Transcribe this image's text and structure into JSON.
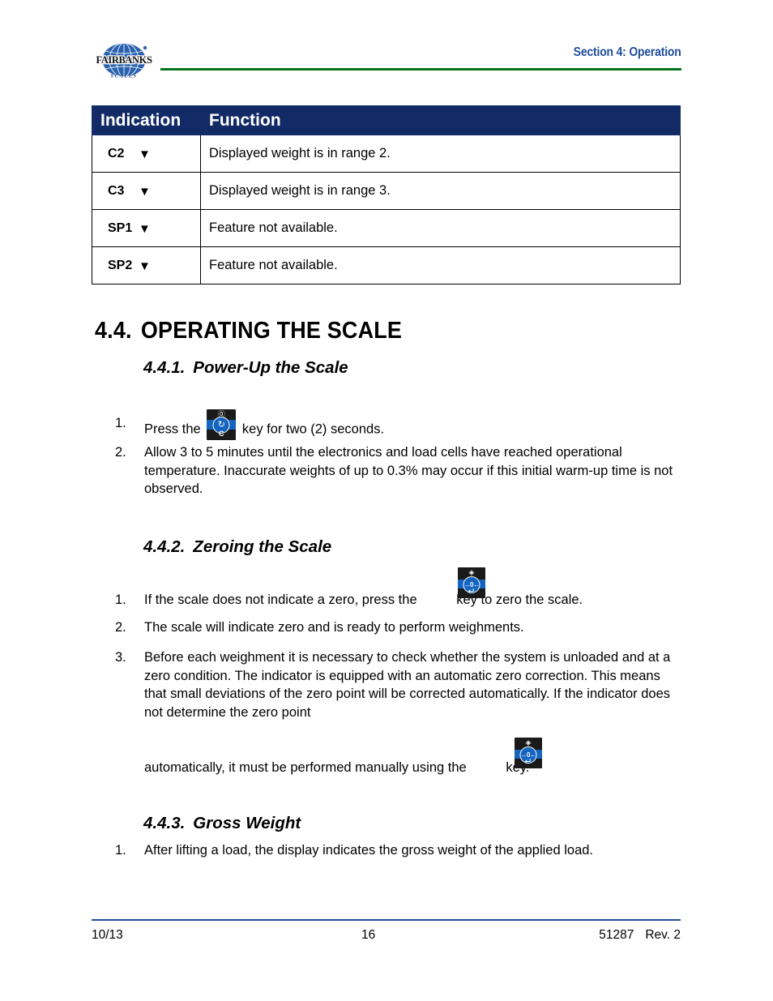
{
  "header": {
    "logo_name": "FAIRBANKS",
    "logo_sub": "S C A L E S",
    "section_title": "Section 4: Operation"
  },
  "table": {
    "columns": [
      "Indication",
      "Function"
    ],
    "rows": [
      {
        "code": "C2",
        "arrow": "▼",
        "function": "Displayed weight is in range 2."
      },
      {
        "code": "C3",
        "arrow": "▼",
        "function": "Displayed weight is in range 3."
      },
      {
        "code": "SP1",
        "arrow": "▼",
        "function": "Feature not available."
      },
      {
        "code": "SP2",
        "arrow": "▼",
        "function": "Feature not available."
      }
    ]
  },
  "sections": {
    "main": {
      "number": "4.4.",
      "title": "OPERATING THE SCALE"
    },
    "s441": {
      "number": "4.4.1.",
      "title": "Power-Up the Scale",
      "items": [
        {
          "marker": "1.",
          "text_before": "Press the",
          "text_after": "key for two (2) seconds."
        },
        {
          "marker": "2.",
          "text": "Allow 3 to 5 minutes until the electronics and load cells have reached operational temperature.  Inaccurate weights of up to 0.3% may occur if this initial warm-up time is not observed."
        }
      ]
    },
    "s442": {
      "number": "4.4.2.",
      "title": "Zeroing the Scale",
      "items": [
        {
          "marker": "1.",
          "text_before": "If the scale does not indicate a zero, press the",
          "text_after": "key to zero the scale."
        },
        {
          "marker": "2.",
          "text": "The scale will indicate zero and is ready to perform weighments."
        },
        {
          "marker": "3.",
          "text": "Before each weighment it is necessary to check whether the system is unloaded and at a zero condition.  The indicator is equipped with an automatic zero correction.  This means that small deviations of the zero point will be corrected automatically.  If the indicator does not determine the zero point"
        }
      ],
      "continuation_before": "automatically, it must be performed manually using the",
      "continuation_after": "key."
    },
    "s443": {
      "number": "4.4.3.",
      "title": "Gross Weight",
      "items": [
        {
          "marker": "1.",
          "text": "After lifting a load, the display indicates the gross weight of the applied load."
        }
      ]
    }
  },
  "keys": {
    "power": {
      "top_glyph": "⓪",
      "circle_glyph": "↻",
      "bottom_glyph": "C"
    },
    "zero": {
      "top_glyph": "◈",
      "circle_glyph": "→0←",
      "bottom_glyph": "↵"
    }
  },
  "footer": {
    "date": "10/13",
    "page": "16",
    "doc_number": "51287",
    "revision": "Rev. 2"
  },
  "colors": {
    "table_header_bg": "#122a66",
    "header_rule_green": "#00731a",
    "header_title_blue": "#1f4e9c",
    "footer_rule_blue": "#1f4e9c",
    "key_band_blue": "#1565c0"
  }
}
